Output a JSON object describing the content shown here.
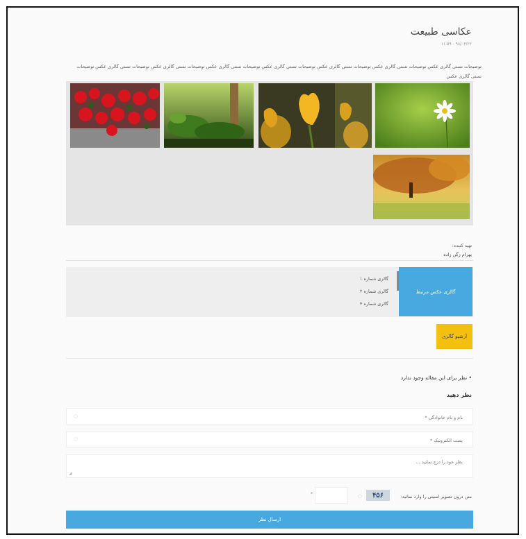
{
  "article": {
    "title": "عکاسی طبیعت",
    "date": "۱۱:۵۹ - ۹۸/۰۳/۲۲",
    "description": "توضیحات تستی گالری عکس توضیحات تستی گالری عکس توضیحات تستی گالری عکس توضیحات تستی گالری عکس توضیحات تستی گالری عکس توضیحات تستی گالری عکس توضیحات تستی گالری عکس توضیحات تستی گالری عکس"
  },
  "gallery": {
    "photos": [
      {
        "subject": "white daisy in green field"
      },
      {
        "subject": "yellow tulips"
      },
      {
        "subject": "green plants"
      },
      {
        "subject": "red flowers"
      },
      {
        "subject": "autumn tree"
      }
    ]
  },
  "author": {
    "label": "تهیه کننده:",
    "name": "بهرام زگن زاده"
  },
  "related": {
    "title": "گالری عکس مرتبط",
    "items": [
      "گالری شماره ۱",
      "گالری شماره ۲",
      "گالری شماره ۴"
    ]
  },
  "archive": {
    "label": "آرشیو گالری"
  },
  "comments": {
    "note": "• نظر برای این مقاله وجود ندارد",
    "heading": "نظر دهید",
    "name_placeholder": "نام و نام خانوادگی *",
    "email_placeholder": "پست الکترونیک *",
    "comment_placeholder": "نظر خود را درج نمایید ...",
    "captcha_label": "متن درون تصویر امنیتی را وارد نمائید:",
    "captcha_text": "۴۵۶",
    "submit_label": "ارسال نظر"
  },
  "colors": {
    "accent_blue": "#48a9e0",
    "archive_yellow": "#f4c010"
  }
}
